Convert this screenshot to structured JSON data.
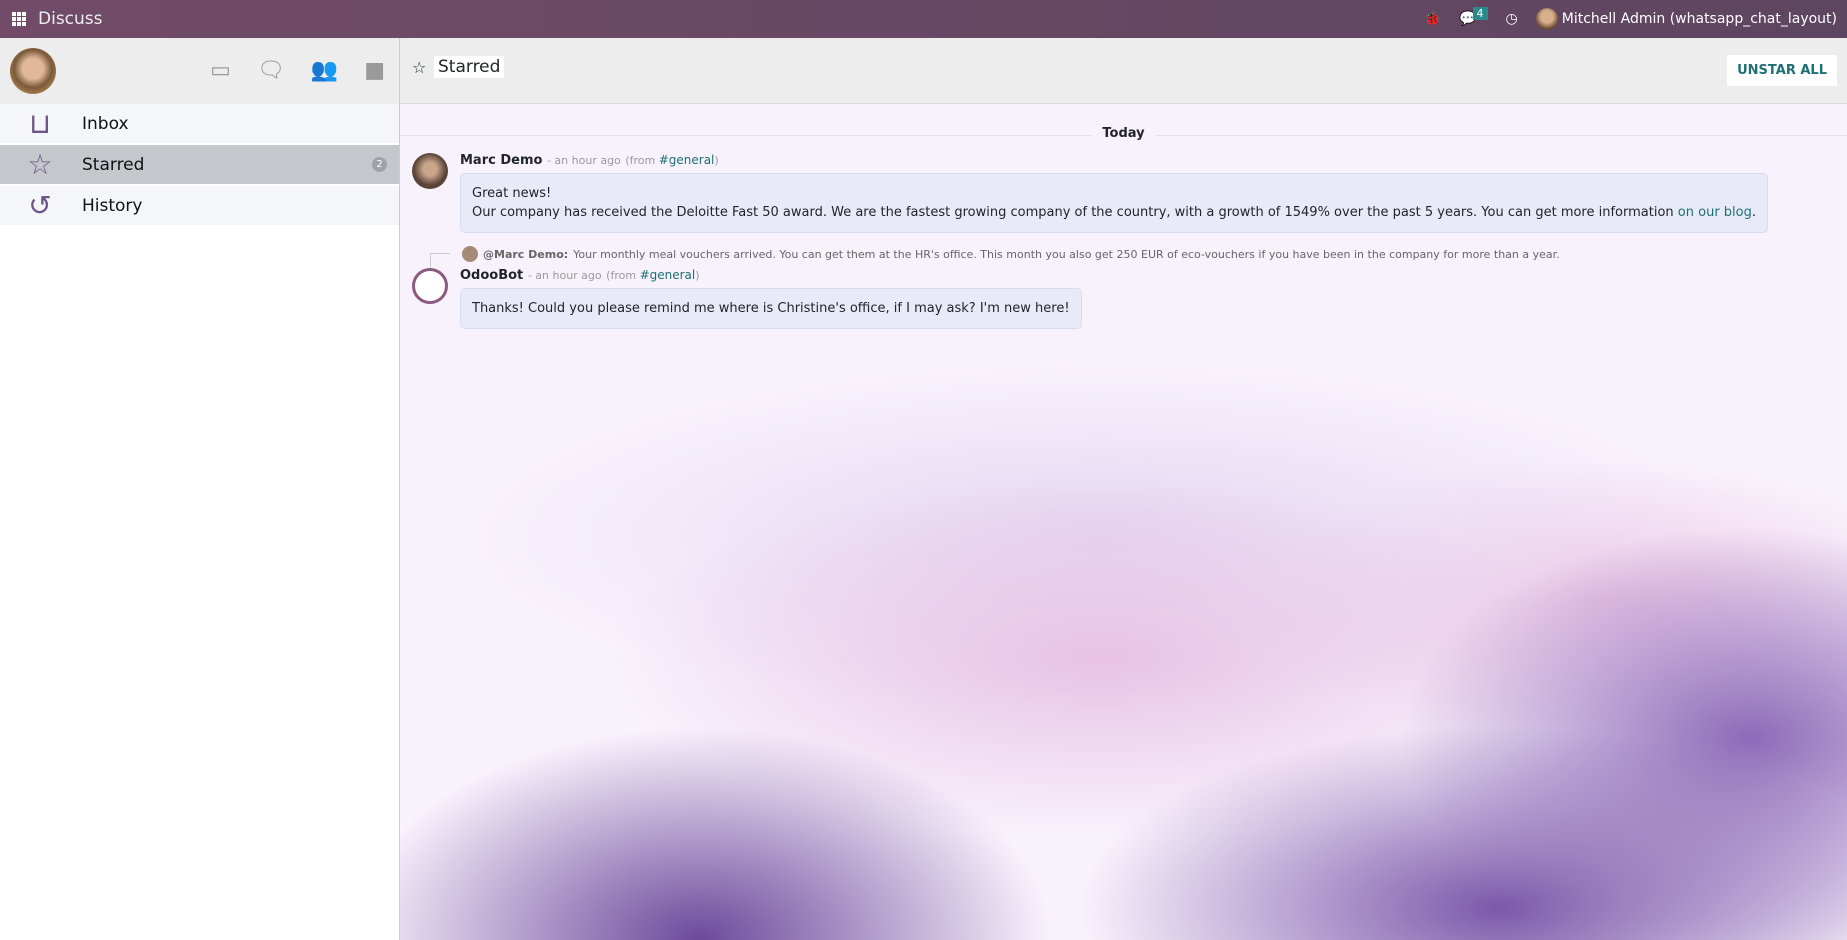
{
  "topbar": {
    "app_name": "Discuss",
    "message_count": "4",
    "user": "Mitchell Admin (whatsapp_chat_layout)"
  },
  "sidebar": {
    "items": [
      {
        "label": "Inbox",
        "icon": "inbox-icon"
      },
      {
        "label": "Starred",
        "icon": "star-icon",
        "count": "2"
      },
      {
        "label": "History",
        "icon": "history-icon"
      }
    ]
  },
  "main": {
    "title": "Starred",
    "unstar_all": "UNSTAR ALL",
    "date_separator": "Today",
    "messages": [
      {
        "author": "Marc Demo",
        "time": "- an hour ago",
        "from_prefix": "(from ",
        "channel": "#general",
        "from_suffix": ")",
        "line1": "Great news!",
        "line2": "Our company has received the Deloitte Fast 50 award. We are the fastest growing company of the country, with a growth of 1549% over the past 5 years. You can get more information ",
        "link": "on our blog",
        "end": "."
      },
      {
        "reply_author": "@Marc Demo:",
        "reply_text": "Your monthly meal vouchers arrived. You can get them at the HR's office. This month you also get 250 EUR of eco-vouchers if you have been in the company for more than a year.",
        "author": "OdooBot",
        "time": "- an hour ago",
        "from_prefix": "(from ",
        "channel": "#general",
        "from_suffix": ")",
        "body": "Thanks! Could you please remind me where is Christine's office, if I may ask? I'm new here!"
      }
    ]
  },
  "colors": {
    "brand": "#714b67",
    "accent": "#1f6f73"
  }
}
